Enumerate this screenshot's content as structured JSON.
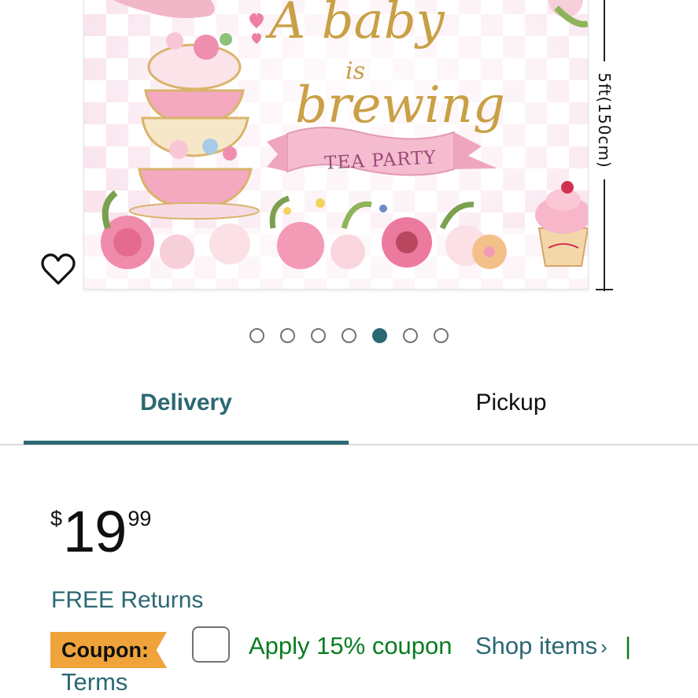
{
  "product_image": {
    "script_title_line1": "A baby",
    "script_title_line2": "is",
    "script_title_line3": "brewing",
    "banner_text": "TEA PARTY",
    "dimension_label": "5ft(150cm)"
  },
  "carousel": {
    "total": 7,
    "active_index": 4
  },
  "tabs": {
    "delivery": "Delivery",
    "pickup": "Pickup",
    "active": "delivery"
  },
  "price": {
    "symbol": "$",
    "whole": "19",
    "fraction": "99"
  },
  "returns": {
    "label": "FREE Returns"
  },
  "coupon": {
    "badge": "Coupon:",
    "apply_text": "Apply 15% coupon",
    "shop_items": "Shop items",
    "shop_chevron": "›",
    "separator": "|",
    "terms": "Terms"
  },
  "colors": {
    "accent": "#2b6873",
    "coupon_badge": "#f0a33a",
    "coupon_green": "#067d20",
    "backdrop_pink": "#f9e4ee",
    "gold_script": "#c9a045"
  },
  "icons": {
    "wishlist": "heart-outline-icon"
  }
}
